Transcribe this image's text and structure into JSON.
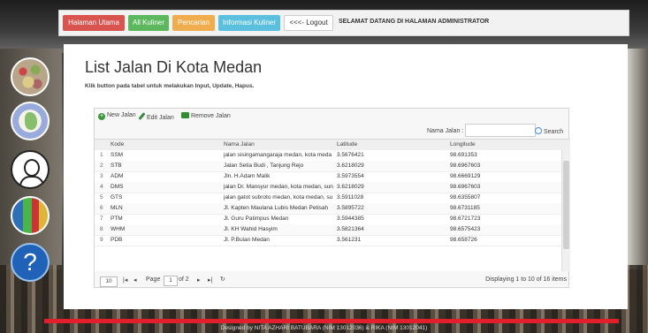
{
  "nav": {
    "home": "Halaman Utama",
    "all_kuliner": "All Kuliner",
    "pencarian": "Pencarian",
    "info_kuliner": "Informasi Kuliner",
    "logout": "<<<- Logout",
    "welcome": "SELAMAT DATANG DI HALAMAN ADMINISTRATOR"
  },
  "page": {
    "title": "List Jalan Di Kota Medan",
    "subtitle": "Klik button pada tabel untuk melakukan Input, Update, Hapus."
  },
  "toolbar": {
    "add_label": "New Jalan",
    "edit_label": "Edit Jalan",
    "remove_label": "Remove Jalan"
  },
  "search": {
    "label": "Nama Jalan :",
    "value": "",
    "button": "Search"
  },
  "table": {
    "columns": [
      "Kode",
      "Nama Jalan",
      "Latitude",
      "Longitude"
    ],
    "rows": [
      {
        "no": "1",
        "kode": "SSM",
        "nama": "jalan sisingamangaraja medan, kota meda",
        "lat": "3.5676421",
        "lng": "98.691353"
      },
      {
        "no": "2",
        "kode": "STB",
        "nama": "Jalan Setia Budi , Tanjung Rejo",
        "lat": "3.6218029",
        "lng": "98.6967603"
      },
      {
        "no": "3",
        "kode": "ADM",
        "nama": "Jln. H.Adam Malik",
        "lat": "3.5973554",
        "lng": "98.6669129"
      },
      {
        "no": "4",
        "kode": "DMS",
        "nama": "jalan Dr. Mansyur medan, kota medan, sun",
        "lat": "3.6218029",
        "lng": "98.6967603"
      },
      {
        "no": "5",
        "kode": "GTS",
        "nama": "jalan gatot subroto medan, kota medan, su",
        "lat": "3.5911028",
        "lng": "98.6355807"
      },
      {
        "no": "6",
        "kode": "MLN",
        "nama": "Jl. Kapten Maulana Lubis Medan Petisah",
        "lat": "3.5895722",
        "lng": "98.6731185"
      },
      {
        "no": "7",
        "kode": "PTM",
        "nama": "Jl. Guru Patimpus Medan",
        "lat": "3.5944385",
        "lng": "98.6721723"
      },
      {
        "no": "8",
        "kode": "WHM",
        "nama": "Jl. KH Wahid Hasyim",
        "lat": "3.5821364",
        "lng": "98.6575423"
      },
      {
        "no": "9",
        "kode": "PDB",
        "nama": "Jl. P.Bulan Medan",
        "lat": "3.561231",
        "lng": "98.658726"
      }
    ]
  },
  "pager": {
    "page_size": "10",
    "page_label": "Page",
    "page_value": "1",
    "of_label": "of 2",
    "info": "Displaying 1 to 10 of 16 items"
  },
  "footer": {
    "text": "Designed by NITA AZHARI BATUBARA (NIM 13012036) & RIKA (NIM 13012041)"
  },
  "colors": {
    "home": "#d9534f",
    "kuliner": "#5cb85c",
    "pencarian": "#f0ad4e",
    "info": "#5bc0de",
    "footer_accent": "#e21f2b"
  }
}
